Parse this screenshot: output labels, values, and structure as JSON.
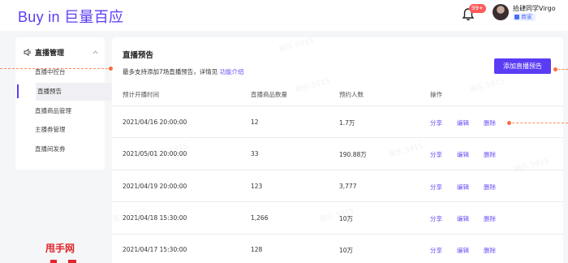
{
  "header": {
    "logo_text": "Buy in 巨量百应",
    "notification_badge": "99+",
    "user_name": "拾肆同学Virgo",
    "user_role": "商家"
  },
  "sidebar": {
    "section_title": "直播管理",
    "items": [
      {
        "label": "直播中控台"
      },
      {
        "label": "直播预告"
      },
      {
        "label": "直播商品管理"
      },
      {
        "label": "主播券管理"
      },
      {
        "label": "直播间发券"
      }
    ],
    "active_index": 1
  },
  "main": {
    "title": "直播预告",
    "description": "最多支持添加7场直播预告，详情见",
    "description_link": "功能介绍",
    "add_button": "添加直播预告",
    "columns": [
      "预计开播时间",
      "直播商品数量",
      "预约人数",
      "操作"
    ],
    "rows": [
      {
        "time": "2021/04/16  20:00:00",
        "count": "12",
        "reservations": "1.7万"
      },
      {
        "time": "2021/05/01  20:00:00",
        "count": "33",
        "reservations": "190.88万"
      },
      {
        "time": "2021/04/19  20:00:00",
        "count": "123",
        "reservations": "3,777"
      },
      {
        "time": "2021/04/18  15:30:00",
        "count": "1,266",
        "reservations": "10万"
      },
      {
        "time": "2021/04/17  15:30:00",
        "count": "128",
        "reservations": "10万"
      }
    ],
    "actions": {
      "share": "分享",
      "edit": "编辑",
      "delete": "删除"
    }
  },
  "watermark": {
    "text": "闽乐 5915",
    "brand_text": "甩手网"
  },
  "colors": {
    "accent": "#5b3cf5",
    "link": "#6b4ef6",
    "annotation": "#ff6a3d",
    "badge": "#ff5a5a"
  }
}
